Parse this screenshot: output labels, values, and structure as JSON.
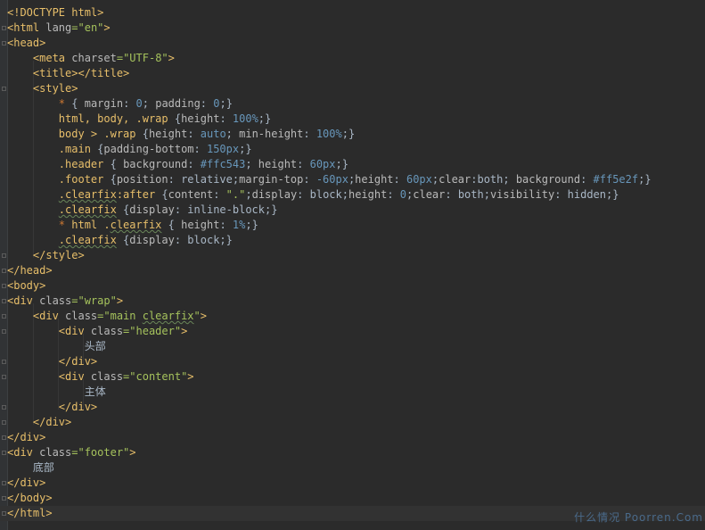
{
  "editor": {
    "lines": [
      "<!DOCTYPE html>",
      "<html lang=\"en\">",
      "<head>",
      "    <meta charset=\"UTF-8\">",
      "    <title></title>",
      "    <style>",
      "        * { margin: 0; padding: 0;}",
      "        html, body, .wrap {height: 100%;}",
      "        body > .wrap {height: auto; min-height: 100%;}",
      "        .main {padding-bottom: 150px;}",
      "        .header { background: #ffc543; height: 60px;}",
      "        .footer {position: relative;margin-top: -60px;height: 60px;clear:both; background: #ff5e2f;}",
      "        .clearfix:after {content: \".\";display: block;height: 0;clear: both;visibility: hidden;}",
      "        .clearfix {display: inline-block;}",
      "        * html .clearfix { height: 1%;}",
      "        .clearfix {display: block;}",
      "    </style>",
      "</head>",
      "<body>",
      "<div class=\"wrap\">",
      "    <div class=\"main clearfix\">",
      "        <div class=\"header\">",
      "            头部",
      "        </div>",
      "        <div class=\"content\">",
      "            主体",
      "        </div>",
      "    </div>",
      "</div>",
      "<div class=\"footer\">",
      "    底部",
      "</div>",
      "</body>",
      "</html>"
    ],
    "watermark": "什么情况 Poorren.Com"
  }
}
